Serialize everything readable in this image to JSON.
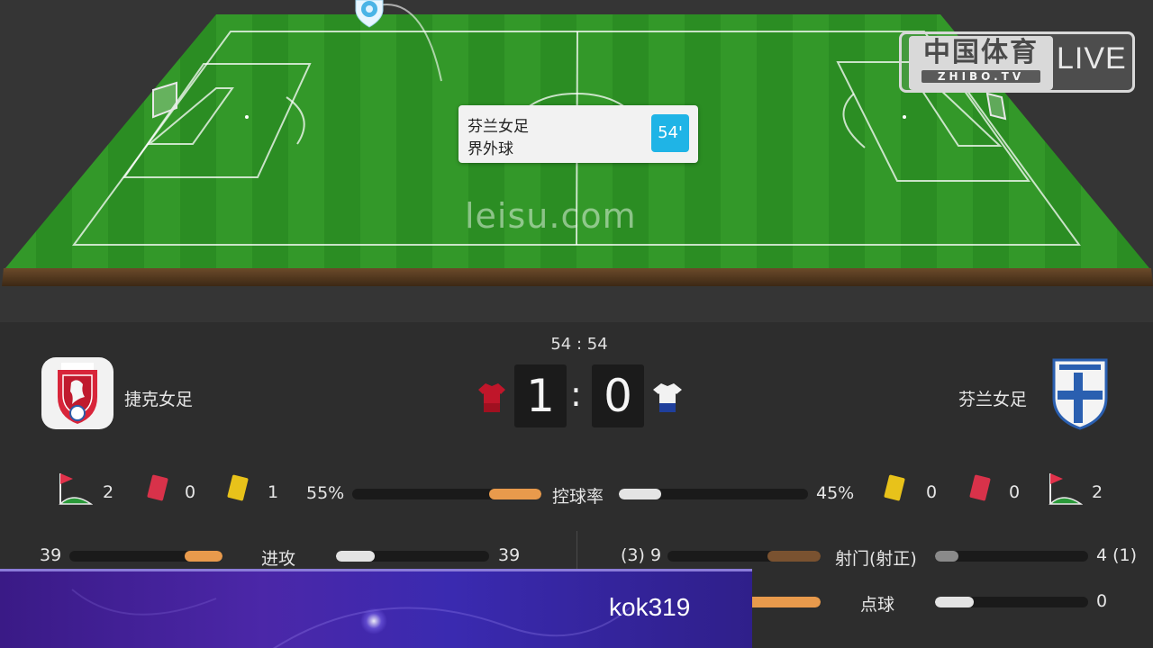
{
  "pitch": {
    "watermark": "leisu.com",
    "event": {
      "team": "芬兰女足",
      "description": "界外球",
      "minute": "54'"
    },
    "brand": {
      "cn": "中国体育",
      "sub": "ZHIBO.TV",
      "live": "LIVE"
    }
  },
  "match": {
    "clock": "54 : 54",
    "home": {
      "name": "捷克女足",
      "score": "1",
      "kit_color": "#c0162a"
    },
    "away": {
      "name": "芬兰女足",
      "score": "0",
      "kit_color": "#f2f2f2"
    },
    "separator": ":"
  },
  "stats": {
    "home_corners": "2",
    "home_red": "0",
    "home_yellow": "1",
    "away_yellow": "0",
    "away_red": "0",
    "away_corners": "2",
    "possession": {
      "label": "控球率",
      "home": "55%",
      "away": "45%",
      "home_fraction": 0.55,
      "away_fraction": 0.45
    },
    "attacks": {
      "label": "进攻",
      "home": "39",
      "away": "39",
      "home_fraction": 0.5,
      "away_fraction": 0.5
    },
    "shots": {
      "label": "射门(射正)",
      "home": "(3) 9",
      "away": "4 (1)",
      "home_fraction": 0.69,
      "away_fraction": 0.31
    },
    "penalties": {
      "label": "点球",
      "home": "",
      "away": "0",
      "home_fraction": 1.0,
      "away_fraction": 0.5
    }
  },
  "overlay": {
    "streamer": "kok319"
  },
  "colors": {
    "accent_orange": "#e89a4c",
    "minute_badge": "#1fb4e6",
    "yellow_card": "#e8c21a",
    "red_card": "#d8324a"
  }
}
